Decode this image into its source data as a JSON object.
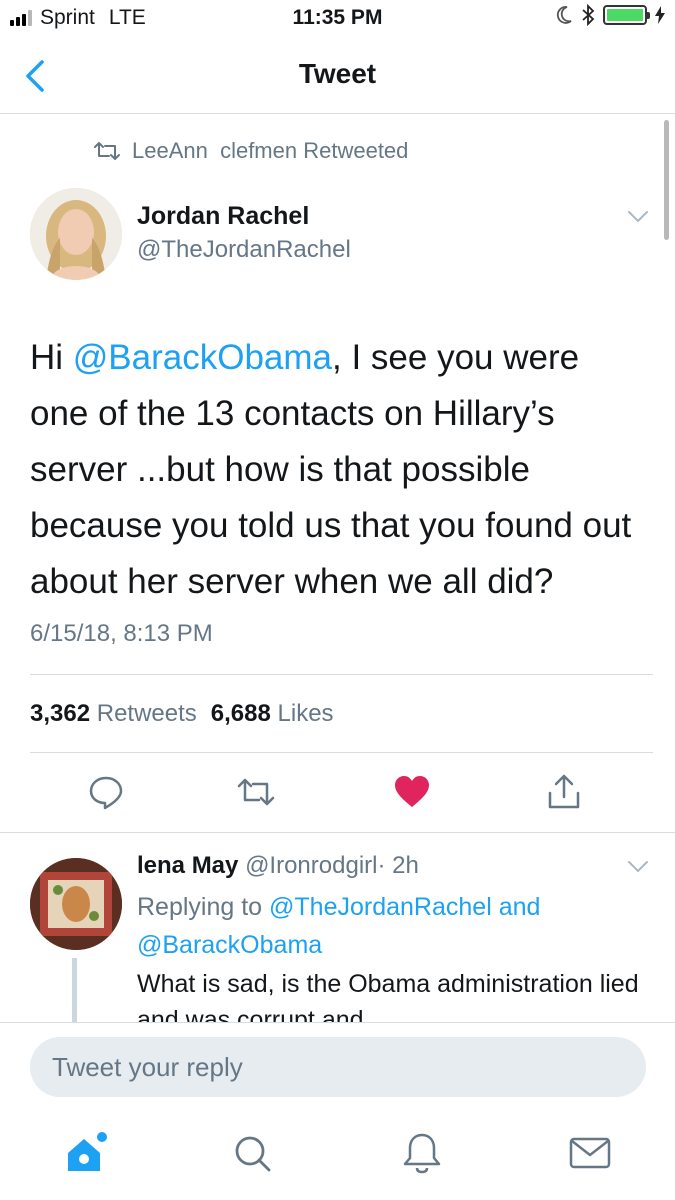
{
  "status_bar": {
    "carrier": "Sprint",
    "network": "LTE",
    "time": "11:35 PM"
  },
  "nav": {
    "title": "Tweet"
  },
  "retweet_context": {
    "text": "LeeAnn  clefmen Retweeted"
  },
  "tweet": {
    "author_name": "Jordan Rachel",
    "author_handle": "@TheJordanRachel",
    "text_prefix": "Hi ",
    "mention": "@BarackObama",
    "text_rest": ", I see you were one of the 13 contacts on Hillary’s server ...but how is that possible because you told us that you found out about her server when we all did?",
    "timestamp": "6/15/18, 8:13 PM",
    "retweets_count": "3,362",
    "retweets_label": "Retweets",
    "likes_count": "6,688",
    "likes_label": "Likes"
  },
  "reply": {
    "author_name": "lena May",
    "author_handle": "@Ironrodgirl",
    "time": "· 2h",
    "replying_label": "Replying to",
    "replying_mention_1": "@TheJordanRachel",
    "replying_and": " and",
    "replying_mention_2": "@BarackObama",
    "text": "What is sad, is the Obama administration lied and was corrupt and"
  },
  "composer": {
    "placeholder": "Tweet your reply"
  },
  "colors": {
    "accent": "#1da1f2",
    "like": "#e0245e",
    "muted": "#657786"
  },
  "icons": {
    "back": "chevron-left-icon",
    "caret": "chevron-down-icon",
    "reply": "speech-bubble-icon",
    "retweet": "retweet-icon",
    "like": "heart-icon",
    "share": "share-icon",
    "home": "home-icon",
    "search": "search-icon",
    "notifications": "bell-icon",
    "messages": "envelope-icon"
  }
}
